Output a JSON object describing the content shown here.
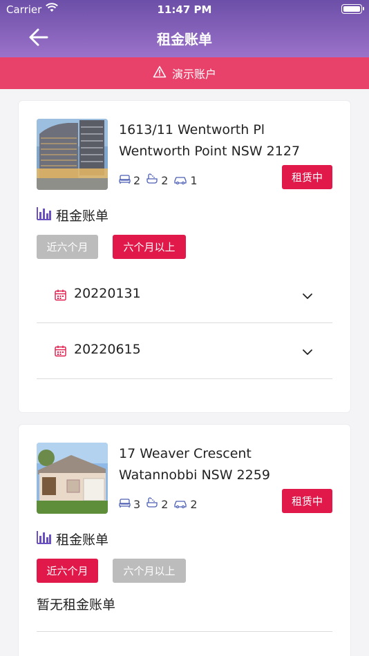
{
  "status_bar": {
    "carrier": "Carrier",
    "time": "11:47 PM"
  },
  "nav": {
    "title": "租金账单",
    "back_icon": "arrow-left-icon"
  },
  "banner": {
    "text": "演示账户",
    "icon": "warning-icon"
  },
  "colors": {
    "accent": "#e0194a",
    "header_top": "#6c4fa8",
    "header_bottom": "#9b72c9",
    "banner": "#e8416a",
    "inactive": "#bcbcbc"
  },
  "properties": [
    {
      "address_line1": "1613/11 Wentworth Pl",
      "address_line2": "Wentworth Point NSW 2127",
      "beds": "2",
      "baths": "2",
      "cars": "1",
      "status": "租赁中",
      "section_title": "租金账单",
      "tabs": [
        {
          "label": "近六个月",
          "active": false
        },
        {
          "label": "六个月以上",
          "active": true
        }
      ],
      "bills": [
        {
          "date": "20220131"
        },
        {
          "date": "20220615"
        }
      ]
    },
    {
      "address_line1": "17 Weaver Crescent",
      "address_line2": "Watannobbi NSW 2259",
      "beds": "3",
      "baths": "2",
      "cars": "2",
      "status": "租赁中",
      "section_title": "租金账单",
      "tabs": [
        {
          "label": "近六个月",
          "active": true
        },
        {
          "label": "六个月以上",
          "active": false
        }
      ],
      "empty_text": "暂无租金账单"
    }
  ]
}
